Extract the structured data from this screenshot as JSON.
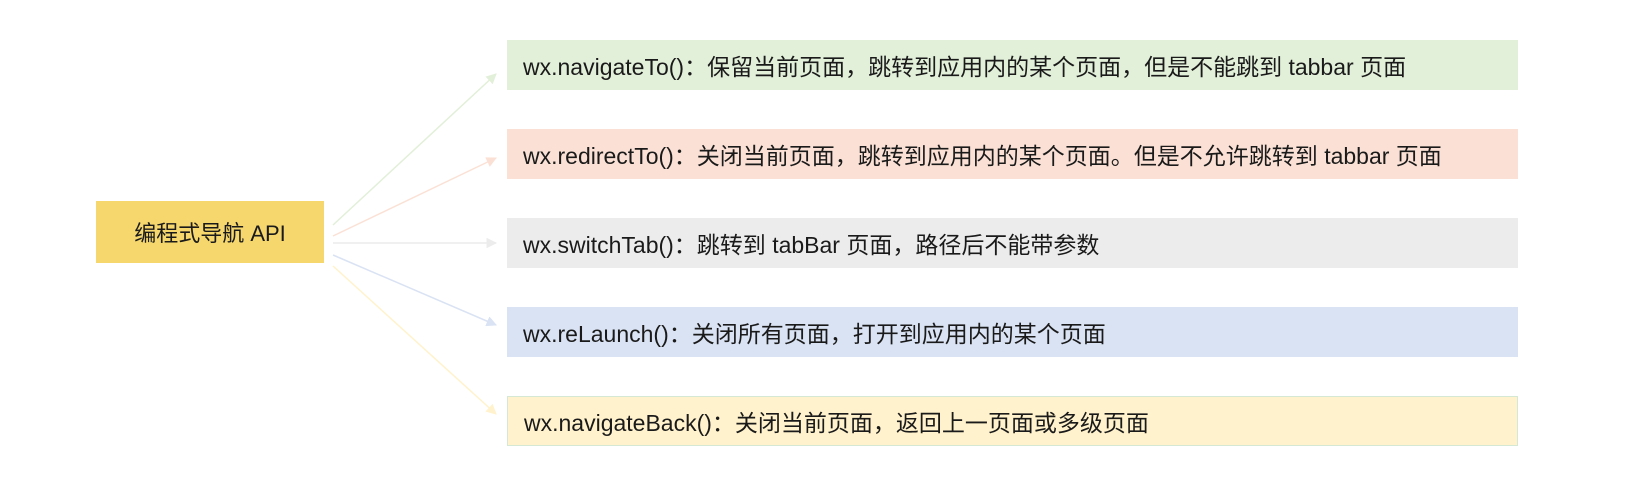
{
  "root": {
    "label": "编程式导航 API",
    "color": "#f5d76e"
  },
  "apis": [
    {
      "text": "wx.navigateTo()：保留当前页面，跳转到应用内的某个页面，但是不能跳到 tabbar 页面",
      "color": "#e2efd9",
      "arrow_color": "#e2efd9"
    },
    {
      "text": "wx.redirectTo()：关闭当前页面，跳转到应用内的某个页面。但是不允许跳转到 tabbar 页面",
      "color": "#fbe1d5",
      "arrow_color": "#fbe1d5"
    },
    {
      "text": "wx.switchTab()：跳转到 tabBar 页面，路径后不能带参数",
      "color": "#ececec",
      "arrow_color": "#ececec"
    },
    {
      "text": "wx.reLaunch()：关闭所有页面，打开到应用内的某个页面",
      "color": "#dae3f3",
      "arrow_color": "#dae3f3"
    },
    {
      "text": "wx.navigateBack()：关闭当前页面，返回上一页面或多级页面",
      "color": "#fff2cc",
      "arrow_color": "#fff2cc"
    }
  ]
}
